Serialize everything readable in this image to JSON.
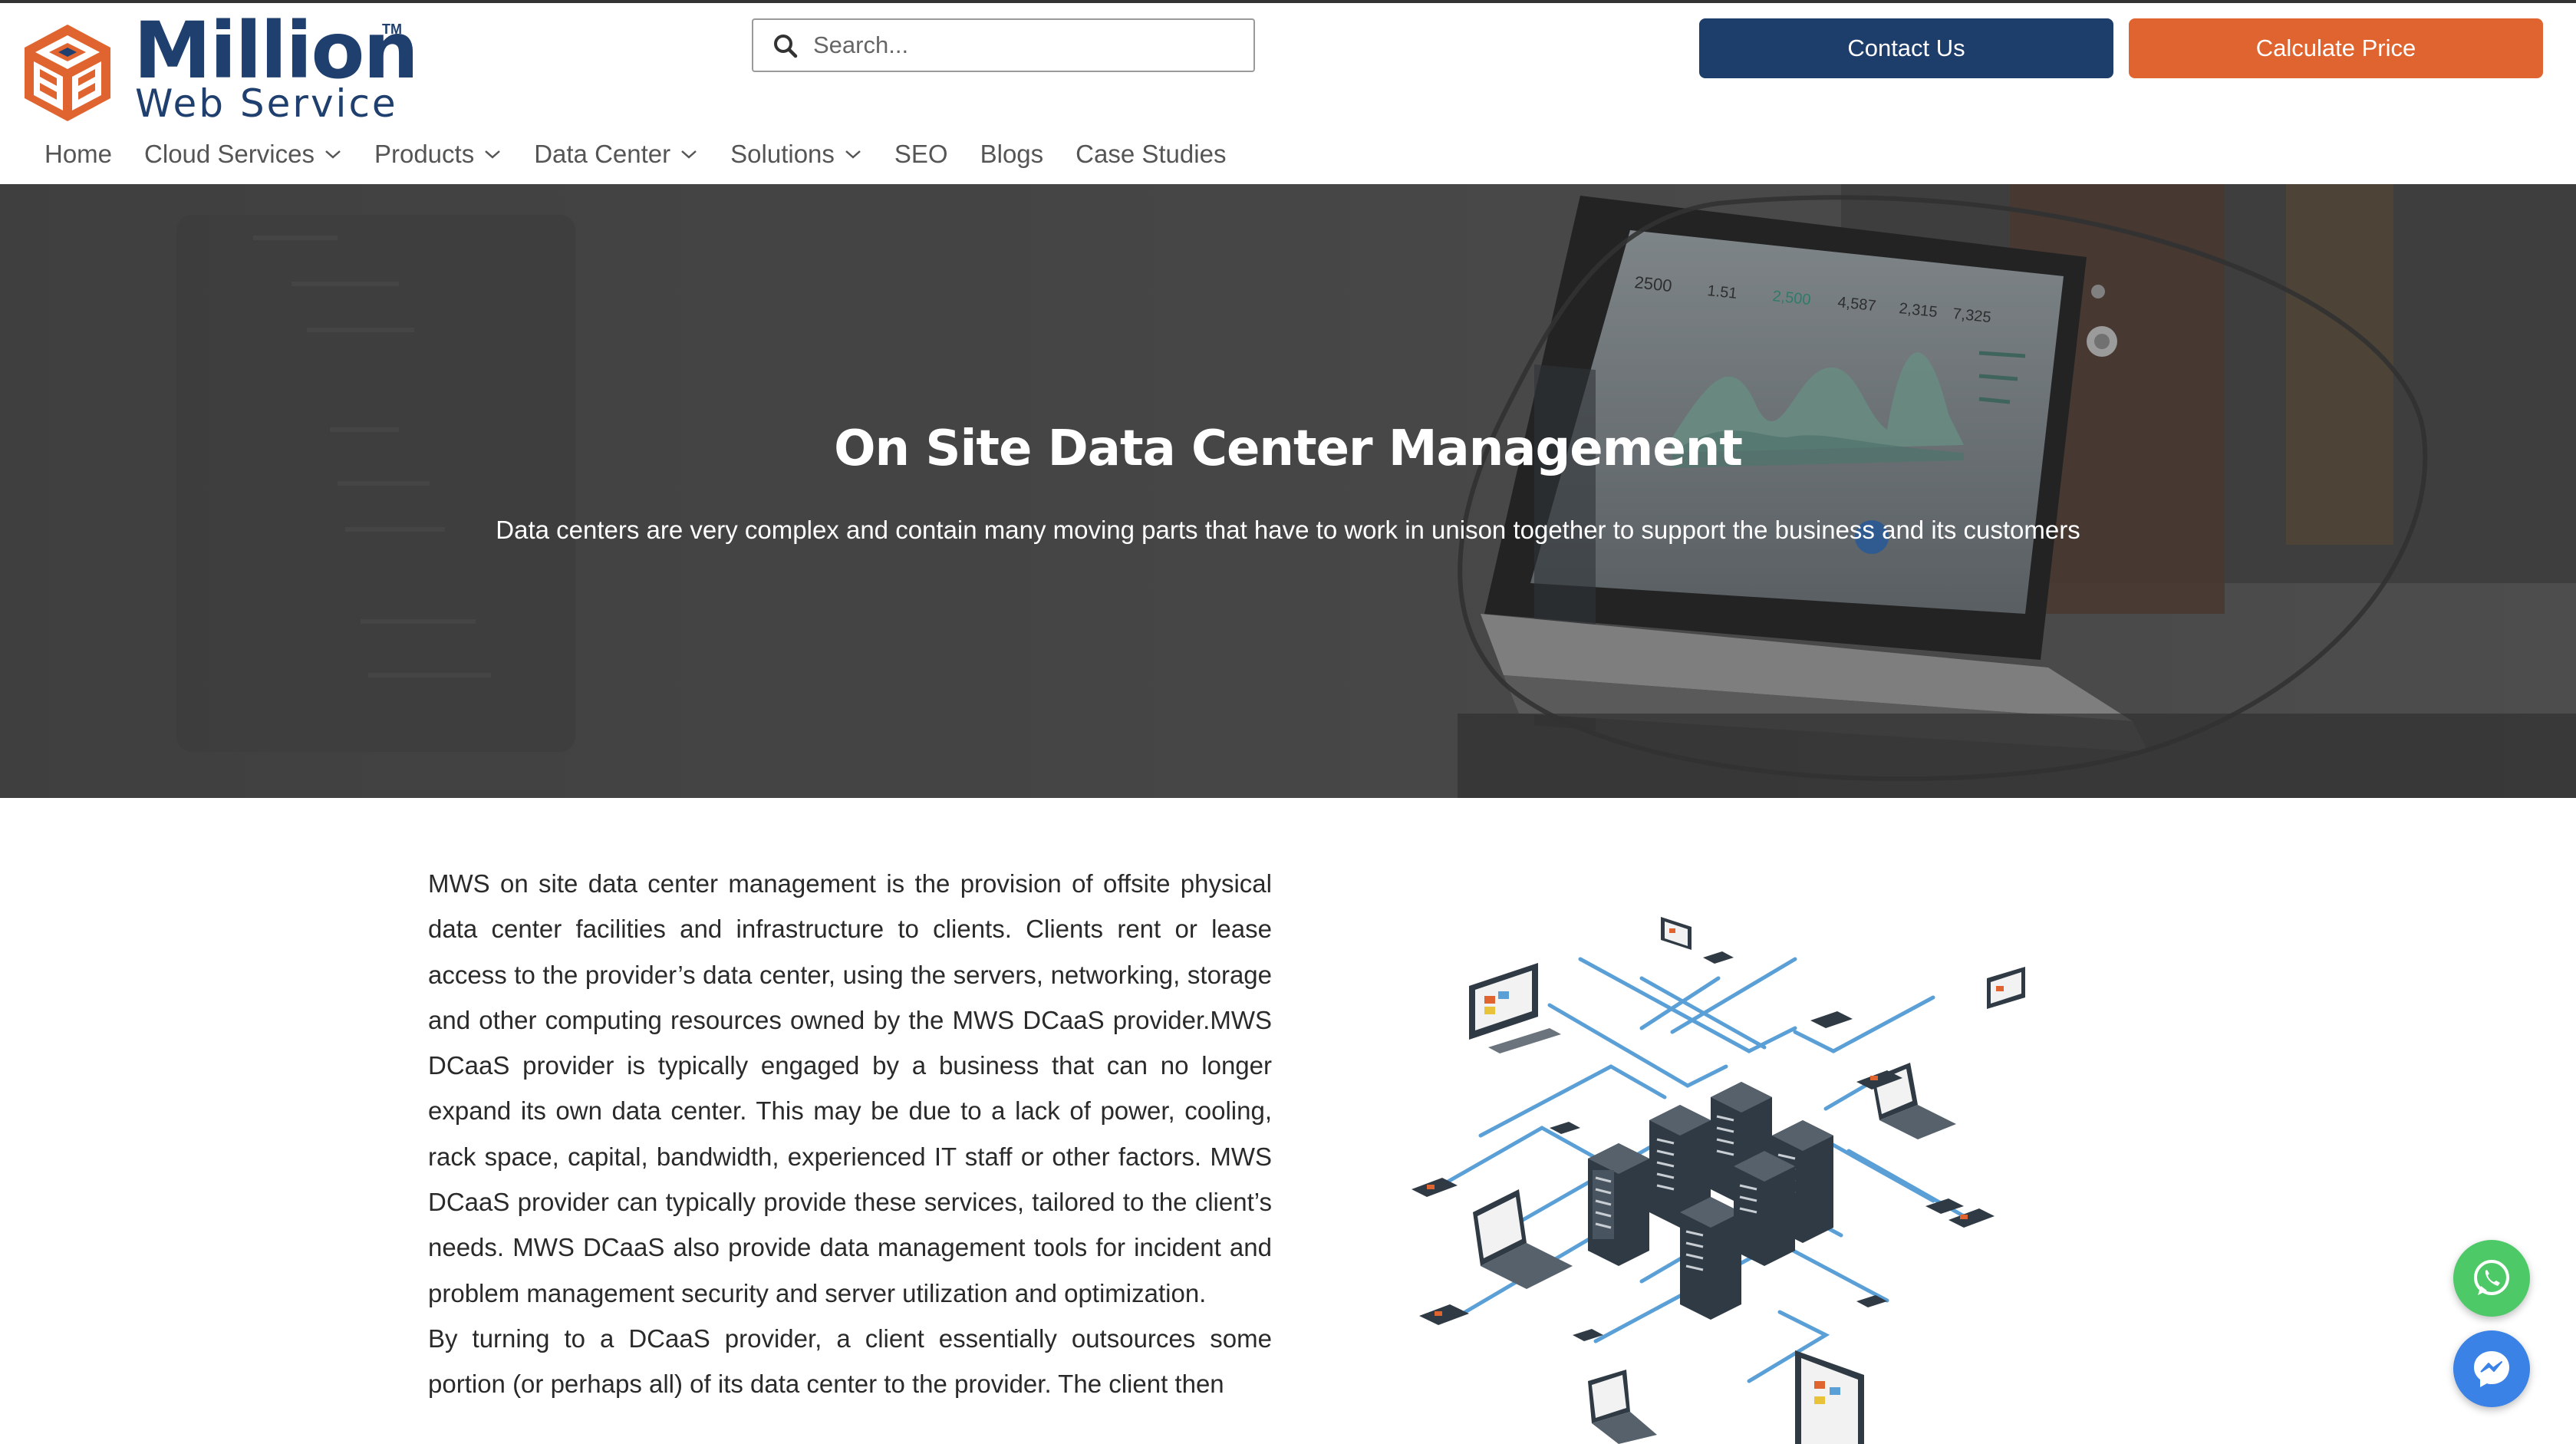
{
  "brand": {
    "name_line1": "Million",
    "name_line2": "Web Service",
    "trademark": "TM",
    "orange": "#e0642f",
    "navy": "#1d3d6b"
  },
  "search": {
    "placeholder": "Search...",
    "icon": "search-icon"
  },
  "header_buttons": {
    "contact": "Contact Us",
    "calculate": "Calculate Price"
  },
  "nav": {
    "items": [
      {
        "label": "Home",
        "dropdown": false
      },
      {
        "label": "Cloud Services",
        "dropdown": true
      },
      {
        "label": "Products",
        "dropdown": true
      },
      {
        "label": "Data Center",
        "dropdown": true
      },
      {
        "label": "Solutions",
        "dropdown": true
      },
      {
        "label": "SEO",
        "dropdown": false
      },
      {
        "label": "Blogs",
        "dropdown": false
      },
      {
        "label": "Case Studies",
        "dropdown": false
      }
    ]
  },
  "hero": {
    "title": "On Site Data Center Management",
    "subtitle": "Data centers are very complex and contain many moving parts that have to work in unison together to support the business and its customers",
    "laptop_stats": [
      "2500",
      "1.51",
      "2,500",
      "4,587",
      "2,315",
      "7,325"
    ]
  },
  "content": {
    "paragraph1": "MWS on site data center management is the provision of offsite physical data center facilities and infrastructure to clients. Clients rent or lease access to the provider’s data center, using the servers, networking, storage and other computing resources owned by the MWS DCaaS provider.MWS DCaaS provider is typically engaged by a business that can no longer expand its own data center. This may be due to a lack of power, cooling, rack space, capital, bandwidth, experienced IT staff or other factors. MWS DCaaS provider can typically provide these services, tailored to the client’s needs. MWS DCaaS also provide data management tools for incident and problem management security and server utilization and optimization.",
    "paragraph2": "By turning to a DCaaS provider, a client essentially outsources some portion (or perhaps all) of its data center to the provider. The client then"
  },
  "floating": {
    "whatsapp": "whatsapp-icon",
    "messenger": "messenger-icon"
  }
}
